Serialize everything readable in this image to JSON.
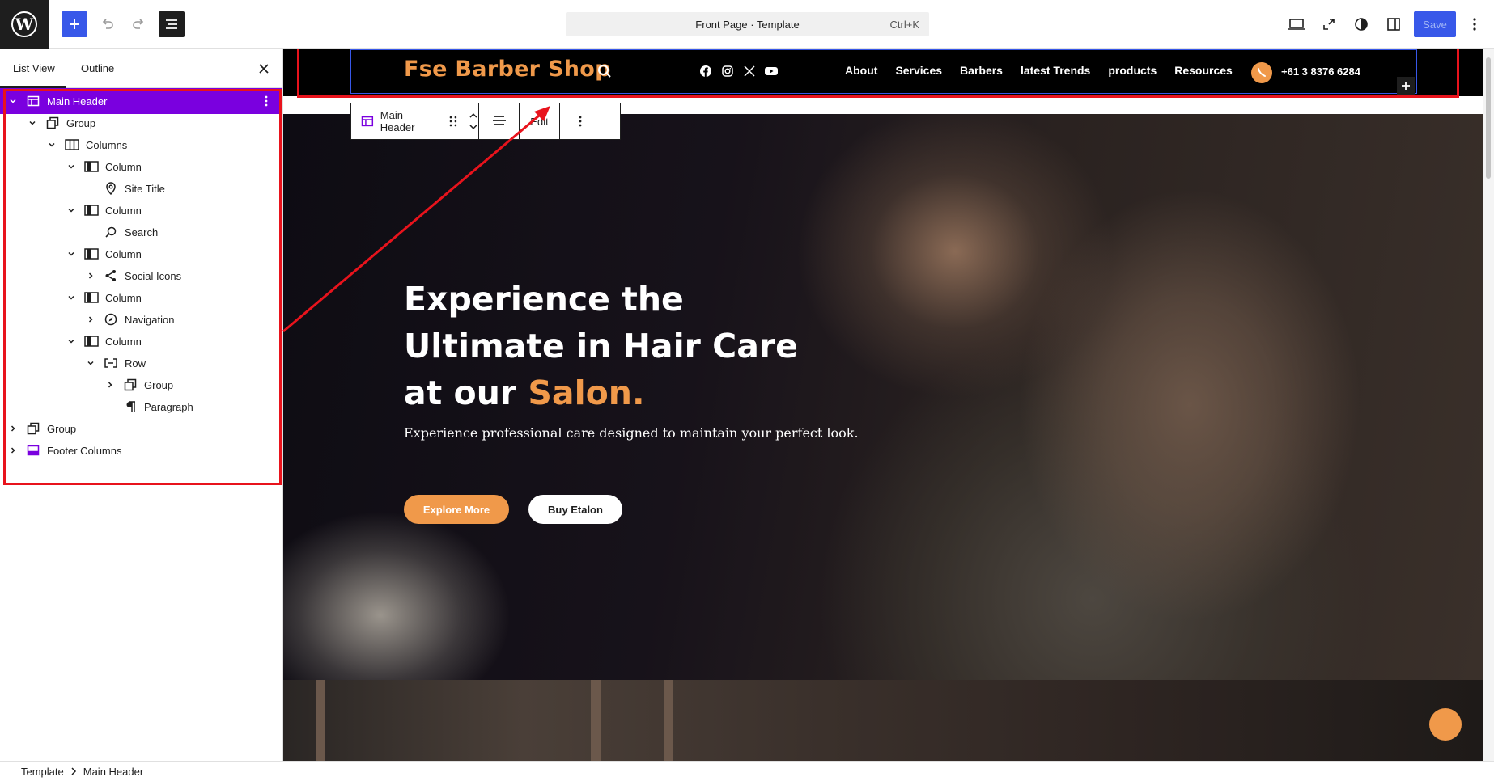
{
  "topbar": {
    "command": "Front Page · Template",
    "shortcut": "Ctrl+K",
    "save_label": "Save"
  },
  "sidebar": {
    "tab_list": "List View",
    "tab_outline": "Outline",
    "nodes": [
      {
        "label": "Main Header"
      },
      {
        "label": "Group"
      },
      {
        "label": "Columns"
      },
      {
        "label": "Column"
      },
      {
        "label": "Site Title"
      },
      {
        "label": "Column"
      },
      {
        "label": "Search"
      },
      {
        "label": "Column"
      },
      {
        "label": "Social Icons"
      },
      {
        "label": "Column"
      },
      {
        "label": "Navigation"
      },
      {
        "label": "Column"
      },
      {
        "label": "Row"
      },
      {
        "label": "Group"
      },
      {
        "label": "Paragraph"
      },
      {
        "label": "Group"
      },
      {
        "label": "Footer Columns"
      }
    ]
  },
  "header": {
    "site_title": "Fse Barber Shop",
    "nav": [
      "About",
      "Services",
      "Barbers",
      "latest Trends",
      "products",
      "Resources"
    ],
    "phone": "+61 3 8376 6284"
  },
  "block_toolbar": {
    "label": "Main Header",
    "edit": "Edit"
  },
  "hero": {
    "line1": "Experience the",
    "line2": "Ultimate in Hair Care",
    "line3_prefix": "at our ",
    "line3_accent": "Salon.",
    "subtitle": "Experience professional care designed to maintain your perfect look.",
    "btn_primary": "Explore More",
    "btn_secondary": "Buy Etalon"
  },
  "breadcrumb": [
    "Template",
    "Main Header"
  ],
  "colors": {
    "accent": "#f0994a",
    "wp_blue": "#3858e9",
    "selection_purple": "#7a00df",
    "annotation_red": "#e8131c"
  }
}
